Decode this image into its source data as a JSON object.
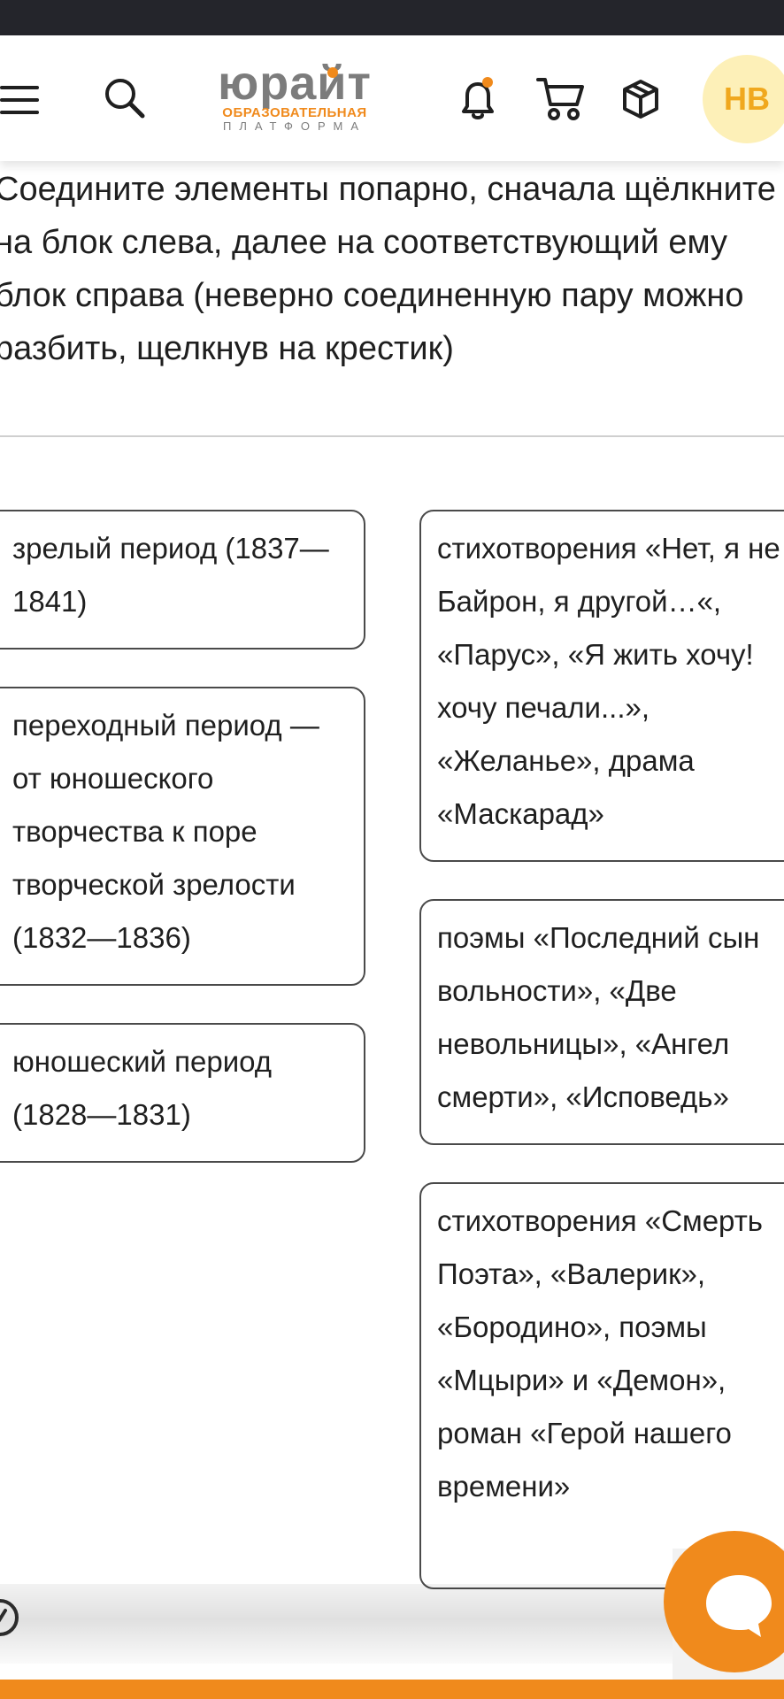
{
  "header": {
    "logo_main": "юрайт",
    "logo_sub1": "ОБРАЗОВАТЕЛЬНАЯ",
    "logo_sub2": "ПЛАТФОРМА",
    "avatar_initials": "НВ",
    "icons": [
      "menu-icon",
      "search-icon",
      "bell-icon",
      "cart-icon",
      "box-icon"
    ]
  },
  "task": {
    "instructions": "Соедините элементы попарно, сначала щёлкните на блок слева, далее на соответствующий ему блок справа (неверно соединенную пару можно разбить, щелкнув на крестик)"
  },
  "left_items": [
    {
      "text": "зрелый период (1837—1841)"
    },
    {
      "text": "переходный период — от юношеского творчества к поре творческой зрелости (1832—1836)"
    },
    {
      "text": "юношеский период (1828—1831)"
    }
  ],
  "right_items": [
    {
      "text": "стихотворения «Нет, я не Байрон, я другой…«, «Парус», «Я жить хочу! хочу печали...», «Желанье», драма «Маскарад»"
    },
    {
      "text": "поэмы «Последний сын вольности», «Две невольницы», «Ангел смерти», «Исповедь»"
    },
    {
      "text": "стихотворения «Смерть Поэта», «Валерик», «Бородино», поэмы «Мцыри» и «Демон», роман «Герой нашего времени»"
    }
  ],
  "colors": {
    "brand_orange": "#f08a1c",
    "logo_gray": "#7c7c7c",
    "status_bar": "#24252b",
    "avatar_bg": "#fdf0b8"
  }
}
